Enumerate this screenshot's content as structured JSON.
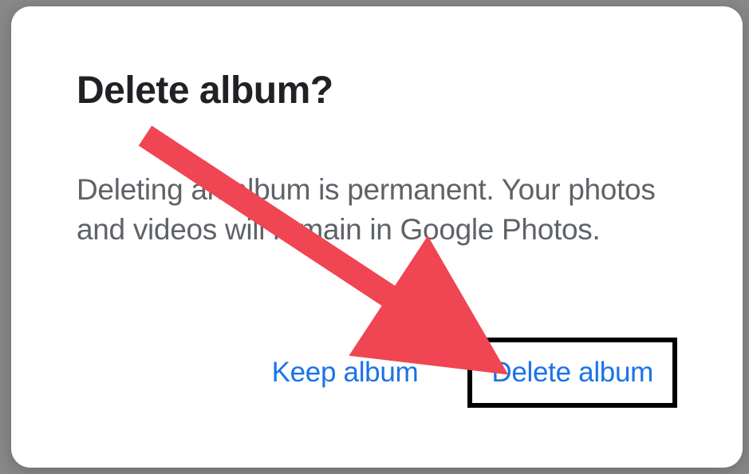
{
  "dialog": {
    "title": "Delete album?",
    "body": "Deleting an album is permanent. Your photos and videos will remain in Google Photos.",
    "keep_label": "Keep album",
    "delete_label": "Delete album"
  },
  "annotation": {
    "arrow_color": "#f04552"
  }
}
